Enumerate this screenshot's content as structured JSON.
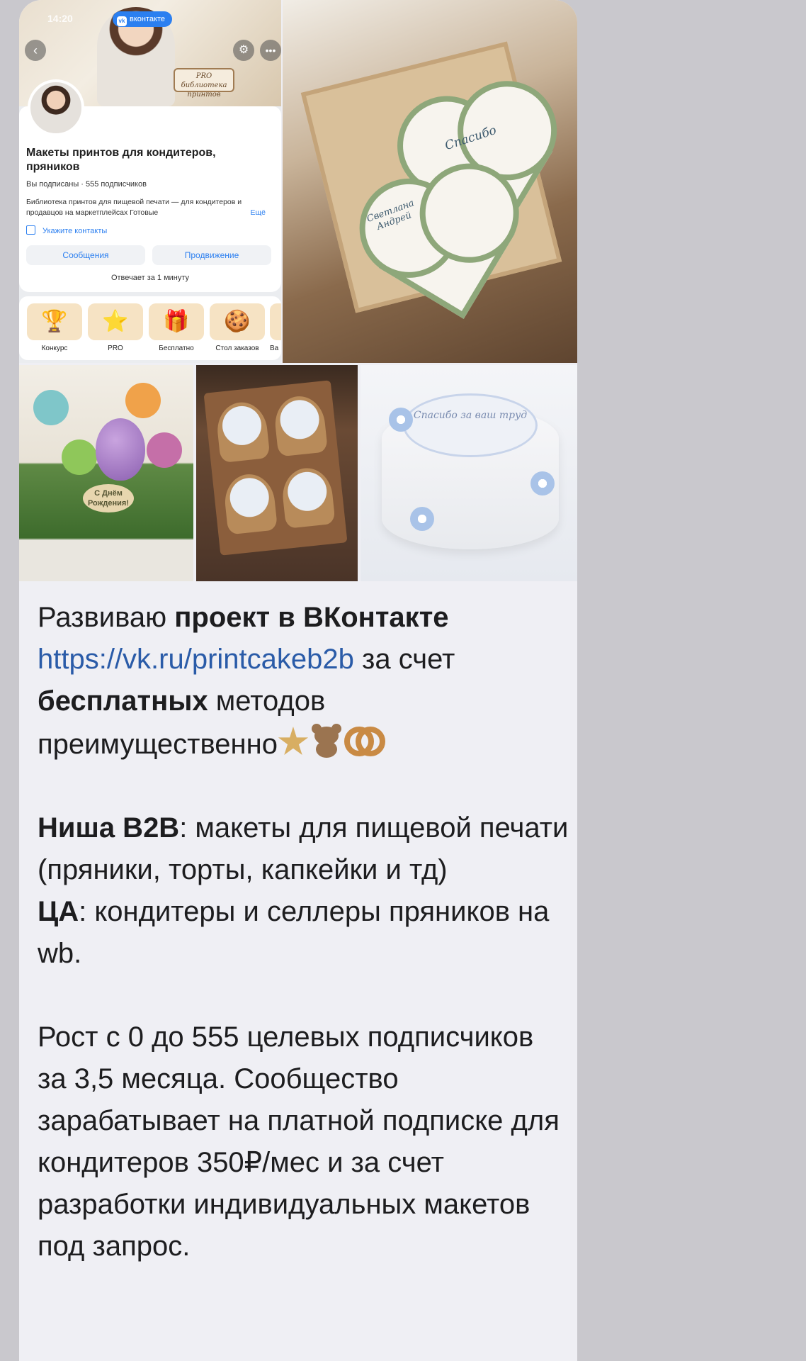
{
  "vk_screenshot": {
    "status_time": "14:20",
    "brand_label": "вконтакте",
    "brand_logo": "vk",
    "cover_sign": "PRO библиотека принтов",
    "group_title": "Макеты принтов для кондитеров, пряников",
    "subscription_line": "Вы подписаны · 555 подписчиков",
    "description": "Библиотека принтов для пищевой печати — для кондитеров и продавцов на маркетплейсах Готовые",
    "more_link": "Ещё",
    "contacts_link": "Укажите контакты",
    "messages_button": "Сообщения",
    "promotion_button": "Продвижение",
    "reply_time": "Отвечает за 1 минуту",
    "shortcuts": [
      {
        "label": "Конкурс",
        "icon": "🏆"
      },
      {
        "label": "PRO",
        "icon": "⭐"
      },
      {
        "label": "Бесплатно",
        "icon": "🎁"
      },
      {
        "label": "Стол заказов",
        "icon": "🍪"
      },
      {
        "label": "Ва",
        "icon": ""
      }
    ]
  },
  "photos": {
    "cookie_text_1": "Спасибо",
    "cookie_text_2": "Светлана Андрей",
    "dino_cake_sign": "С Днём Рождения!",
    "blue_cake_text": "Спасибо за ваш труд"
  },
  "message": {
    "p1_a": "Развиваю ",
    "p1_bold": "проект в ВКонтакте",
    "p1_link": "https://vk.ru/printcakeb2b",
    "p1_b": " за счет ",
    "p1_bold2": "бесплатных",
    "p1_c": " методов преимущественно",
    "niche_label": "Ниша B2B",
    "niche_text": ": макеты для пищевой печати (пряники, торты, капкейки и тд)",
    "audience_label": "ЦА",
    "audience_text": ": кондитеры и селлеры пряников на wb.",
    "growth_text": "Рост с 0 до 555 целевых подписчиков за 3,5 месяца. Сообщество зарабатывает на платной подписке для кондитеров 350₽/мес и за счет разработки индивидуальных макетов под запрос."
  },
  "colors": {
    "background": "#c9c8cd",
    "bubble": "#efeff4",
    "link": "#2a5ba8",
    "vk_blue": "#2b7ff0"
  }
}
